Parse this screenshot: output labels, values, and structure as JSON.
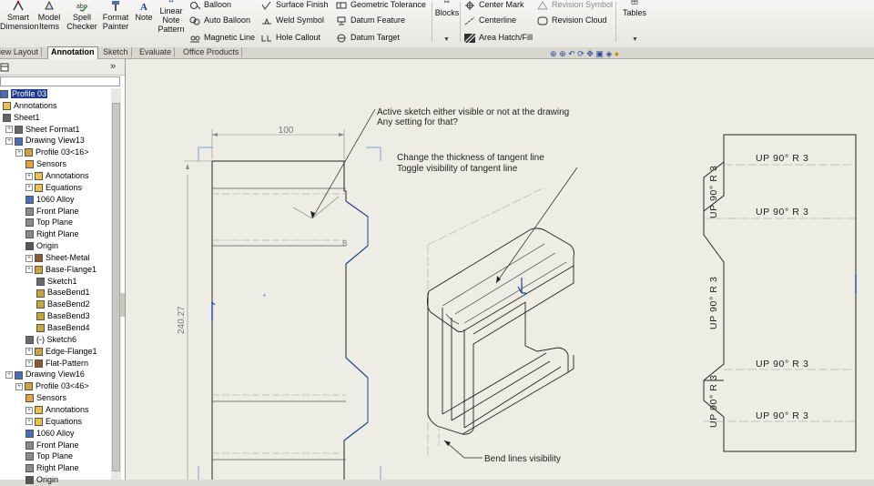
{
  "ribbon": {
    "smart_dimension": {
      "line1": "Smart",
      "line2": "Dimension"
    },
    "model_items": {
      "line1": "Model",
      "line2": "Items"
    },
    "spell_checker": {
      "line1": "Spell",
      "line2": "Checker"
    },
    "format_painter": {
      "line1": "Format",
      "line2": "Painter"
    },
    "note": "Note",
    "linear_note_pattern": {
      "line1": "Linear",
      "line2": "Note",
      "line3": "Pattern"
    },
    "balloon": "Balloon",
    "auto_balloon": "Auto Balloon",
    "magnetic_line": "Magnetic Line",
    "surface_finish": "Surface Finish",
    "weld_symbol": "Weld Symbol",
    "hole_callout": "Hole Callout",
    "geometric_tolerance": "Geometric Tolerance",
    "datum_feature": "Datum Feature",
    "datum_target": "Datum Target",
    "blocks": "Blocks",
    "center_mark": "Center Mark",
    "centerline": "Centerline",
    "area_hatch_fill": "Area Hatch/Fill",
    "revision_symbol": "Revision Symbol",
    "revision_cloud": "Revision Cloud",
    "tables": "Tables"
  },
  "tabs": [
    "View Layout",
    "Annotation",
    "Sketch",
    "Evaluate",
    "Office Products"
  ],
  "active_tab": "Annotation",
  "tree": [
    {
      "label": "Profile 03",
      "selected": true
    },
    {
      "label": "Annotations"
    },
    {
      "label": "Sheet1"
    },
    {
      "label": "Sheet Format1"
    },
    {
      "label": "Drawing View13"
    },
    {
      "label": "Profile 03<16>"
    },
    {
      "label": "Sensors"
    },
    {
      "label": "Annotations"
    },
    {
      "label": "Equations"
    },
    {
      "label": "1060 Alloy"
    },
    {
      "label": "Front Plane"
    },
    {
      "label": "Top Plane"
    },
    {
      "label": "Right Plane"
    },
    {
      "label": "Origin"
    },
    {
      "label": "Sheet-Metal"
    },
    {
      "label": "Base-Flange1"
    },
    {
      "label": "Sketch1"
    },
    {
      "label": "BaseBend1"
    },
    {
      "label": "BaseBend2"
    },
    {
      "label": "BaseBend3"
    },
    {
      "label": "BaseBend4"
    },
    {
      "label": "(-) Sketch6"
    },
    {
      "label": "Edge-Flange1"
    },
    {
      "label": "Flat-Pattern"
    },
    {
      "label": "Drawing View16"
    },
    {
      "label": "Profile 03<46>"
    },
    {
      "label": "Sensors"
    },
    {
      "label": "Annotations"
    },
    {
      "label": "Equations"
    },
    {
      "label": "1060 Alloy"
    },
    {
      "label": "Front Plane"
    },
    {
      "label": "Top Plane"
    },
    {
      "label": "Right Plane"
    },
    {
      "label": "Origin"
    }
  ],
  "panel": {
    "collapse_glyph": "»"
  },
  "drawing": {
    "dim_width": "100",
    "dim_height": "240.27",
    "note_active_sketch": {
      "line1": "Active sketch either visible or not at the drawing",
      "line2": "Any setting for that?"
    },
    "note_tangent": {
      "line1": "Change the thickness of tangent line",
      "line2": "Toggle visibility of tangent line"
    },
    "note_bend": "Bend lines visibility",
    "bend_label": "B",
    "bend_notes_h": [
      "UP 90° R 3",
      "UP 90° R 3",
      "UP 90° R 3",
      "UP 90° R 3"
    ],
    "bend_notes_v": [
      "UP 90° R 3",
      "UP 90° R 3",
      "UP 90° R 3"
    ]
  },
  "colors": {
    "selection": "#1e3a8a",
    "sketch_blue": "#1a3f9e",
    "canvas": "#ededE6"
  }
}
